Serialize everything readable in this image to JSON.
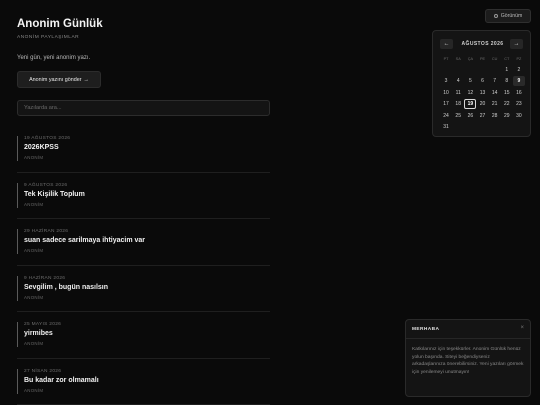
{
  "header": {
    "title": "Anonim Günlük",
    "subtitle": "ANONİM PAYLAŞIMLAR",
    "tagline": "Yeni gün, yeni anonim yazı.",
    "post_button": "Anonim yazını gönder",
    "post_button_arrow": "→"
  },
  "search": {
    "placeholder": "Yazılarda ara..."
  },
  "posts": [
    {
      "date": "19 AĞUSTOS 2026",
      "title": "2026KPSS",
      "author": "ANONİM"
    },
    {
      "date": "9 AĞUSTOS 2026",
      "title": "Tek Kişilik Toplum",
      "author": "ANONİM"
    },
    {
      "date": "29 HAZİRAN 2026",
      "title": "suan sadece sarilmaya ihtiyacim var",
      "author": "ANONİM"
    },
    {
      "date": "9 HAZİRAN 2026",
      "title": "Sevgilim , bugün nasılsın",
      "author": "ANONİM"
    },
    {
      "date": "25 MAYIS 2026",
      "title": "yirmibes",
      "author": "ANONİM"
    },
    {
      "date": "27 NİSAN 2026",
      "title": "Bu kadar zor olmamalı",
      "author": "ANONİM"
    }
  ],
  "theme_toggle": {
    "label": "Görünüm",
    "icon": "circle-half-icon"
  },
  "calendar": {
    "month_label": "AĞUSTOS 2026",
    "prev": "←",
    "next": "→",
    "weekdays": [
      "PT",
      "SA",
      "ÇA",
      "PE",
      "CU",
      "CT",
      "PZ"
    ],
    "leading_blanks": 5,
    "days_in_month": 31,
    "highlighted_days": [
      9
    ],
    "today": 19
  },
  "toast": {
    "title": "MERHABA",
    "close": "×",
    "body": "Katkılarınız için teşekkürler. Anonim Günlük henüz yolun başında. Siteyi beğendiyseniz arkadaşlarınıza önerebilirsiniz. Yeni yazıları görmek için yenilemeyi unutmayın!"
  }
}
